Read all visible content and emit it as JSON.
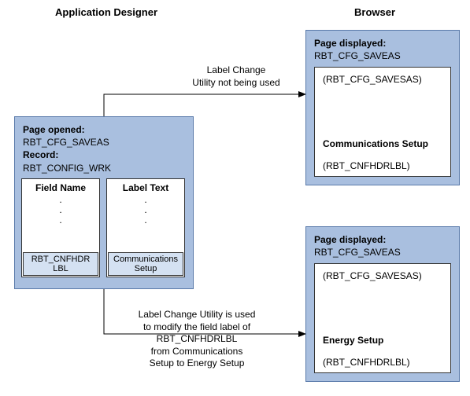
{
  "headings": {
    "left": "Application Designer",
    "right": "Browser"
  },
  "app_designer": {
    "page_opened_label": "Page opened:",
    "page_opened_value": "RBT_CFG_SAVEAS",
    "record_label": "Record:",
    "record_value": "RBT_CONFIG_WRK",
    "col_field": "Field Name",
    "col_label": "Label Text",
    "dots": ".",
    "field_value": "RBT_CNFHDR\nLBL",
    "label_value": "Communications\nSetup"
  },
  "browser_top": {
    "page_displayed_label": "Page displayed:",
    "page_displayed_value": "RBT_CFG_SAVEAS",
    "body_code": "(RBT_CFG_SAVESAS)",
    "setup_title": "Communications Setup",
    "field_code": "(RBT_CNFHDRLBL)"
  },
  "browser_bottom": {
    "page_displayed_label": "Page displayed:",
    "page_displayed_value": "RBT_CFG_SAVEAS",
    "body_code": "(RBT_CFG_SAVESAS)",
    "setup_title": "Energy Setup",
    "field_code": "(RBT_CNFHDRLBL)"
  },
  "annotations": {
    "top": "Label Change\nUtility not being used",
    "bottom": "Label Change Utility is used\nto modify the field label of\nRBT_CNFHDRLBL\nfrom Communications\nSetup to Energy Setup"
  }
}
